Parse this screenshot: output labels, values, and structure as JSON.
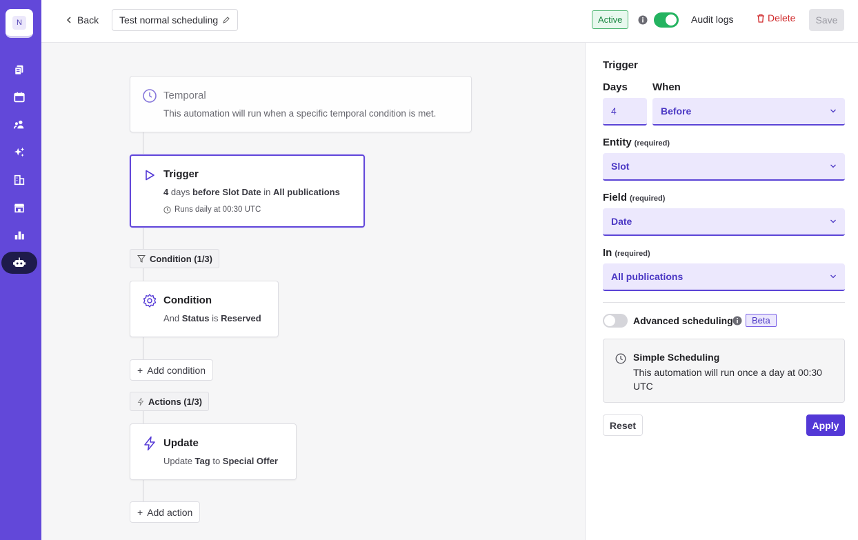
{
  "sidebar": {
    "logo_letter": "N",
    "items": [
      "documents-icon",
      "calendar-icon",
      "people-icon",
      "sparkles-icon",
      "building-icon",
      "store-icon",
      "chart-icon",
      "robot-icon"
    ],
    "accent": "#6248d9"
  },
  "header": {
    "back_label": "Back",
    "title": "Test normal scheduling",
    "status": "Active",
    "audit_label": "Audit logs",
    "delete_label": "Delete",
    "save_label": "Save"
  },
  "flow": {
    "temporal": {
      "title": "Temporal",
      "desc": "This automation will run when a specific temporal condition is met."
    },
    "trigger": {
      "title": "Trigger",
      "days": "4",
      "days_word": "days",
      "when": "before",
      "field": "Slot Date",
      "in_word": "in",
      "in": "All publications",
      "runs": "Runs daily at 00:30 UTC"
    },
    "conditions_label": "Condition (1/3)",
    "condition": {
      "title": "Condition",
      "prefix": "And",
      "field": "Status",
      "op": "is",
      "value": "Reserved"
    },
    "add_condition": "Add condition",
    "actions_label": "Actions (1/3)",
    "action": {
      "title": "Update",
      "prefix": "Update",
      "field": "Tag",
      "op": "to",
      "value": "Special Offer"
    },
    "add_action": "Add action"
  },
  "panel": {
    "heading": "Trigger",
    "days_label": "Days",
    "days_value": "4",
    "when_label": "When",
    "when_value": "Before",
    "entity_label": "Entity",
    "entity_value": "Slot",
    "field_label": "Field",
    "field_value": "Date",
    "in_label": "In",
    "in_value": "All publications",
    "required": "(required)",
    "advanced_label": "Advanced scheduling",
    "beta": "Beta",
    "simple_title": "Simple Scheduling",
    "simple_desc": "This automation will run once a day at 00:30 UTC",
    "reset": "Reset",
    "apply": "Apply"
  }
}
